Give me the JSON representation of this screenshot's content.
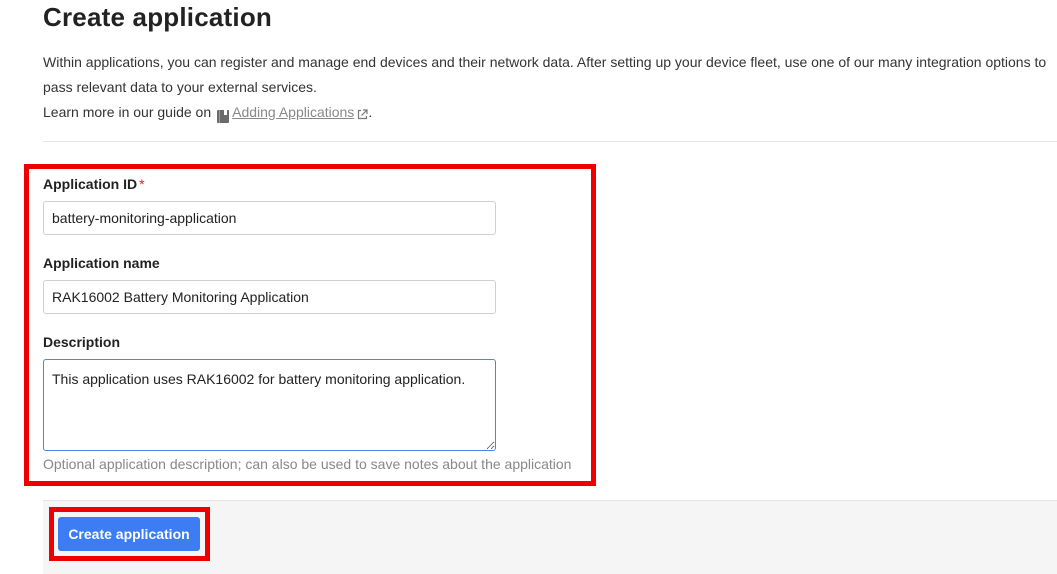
{
  "page": {
    "title": "Create application",
    "intro_line": "Within applications, you can register and manage end devices and their network data. After setting up your device fleet, use one of our many integration options to pass relevant data to your external services.",
    "guide_prefix": "Learn more in our guide on",
    "guide_link_label": "Adding Applications",
    "guide_suffix": "."
  },
  "form": {
    "application_id": {
      "label": "Application ID",
      "required_marker": "*",
      "value": "battery-monitoring-application"
    },
    "application_name": {
      "label": "Application name",
      "value": "RAK16002 Battery Monitoring Application"
    },
    "description": {
      "label": "Description",
      "value": "This application uses RAK16002 for battery monitoring application.",
      "help": "Optional application description; can also be used to save notes about the application"
    },
    "submit_label": "Create application"
  },
  "colors": {
    "primary": "#3d7df4",
    "highlight": "#ee0000",
    "required": "#e02020"
  },
  "icons": {
    "guide": "book-icon",
    "external": "external-link-icon"
  }
}
